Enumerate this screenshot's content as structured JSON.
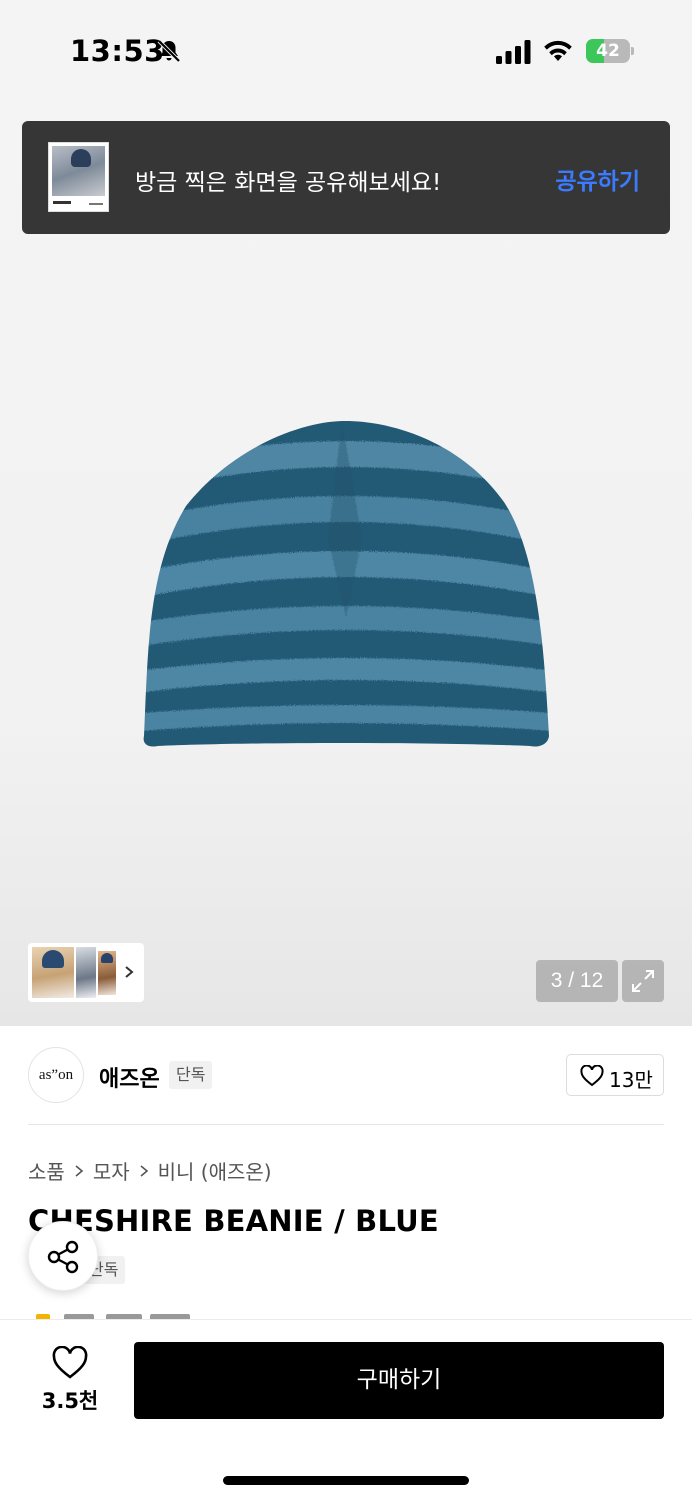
{
  "status_bar": {
    "time": "13:53",
    "battery": "42",
    "battery_level": 0.42
  },
  "share_banner": {
    "message": "방금 찍은 화면을 공유해보세요!",
    "action": "공유하기"
  },
  "gallery": {
    "counter": "3 / 12",
    "thumbnail_count": 3
  },
  "brand": {
    "logo_text": "as”on",
    "name": "애즈온",
    "badge": "단독",
    "likes": "13만"
  },
  "breadcrumb": {
    "items": [
      "소품",
      "모자",
      "비니 (애즈온)"
    ]
  },
  "product": {
    "title": "CHESHIRE BEANIE / BLUE",
    "badge": "단독"
  },
  "bottom_bar": {
    "wish_count": "3.5천",
    "buy_label": "구매하기"
  },
  "icons": [
    "bell-muted-icon",
    "signal-icon",
    "wifi-icon",
    "battery-icon",
    "chevron-right-icon",
    "expand-icon",
    "heart-icon",
    "share-icon"
  ],
  "colors": {
    "banner_bg": "#363636",
    "banner_action": "#3b7bff",
    "buy_button": "#000000",
    "battery_fill": "#3dc75a"
  }
}
